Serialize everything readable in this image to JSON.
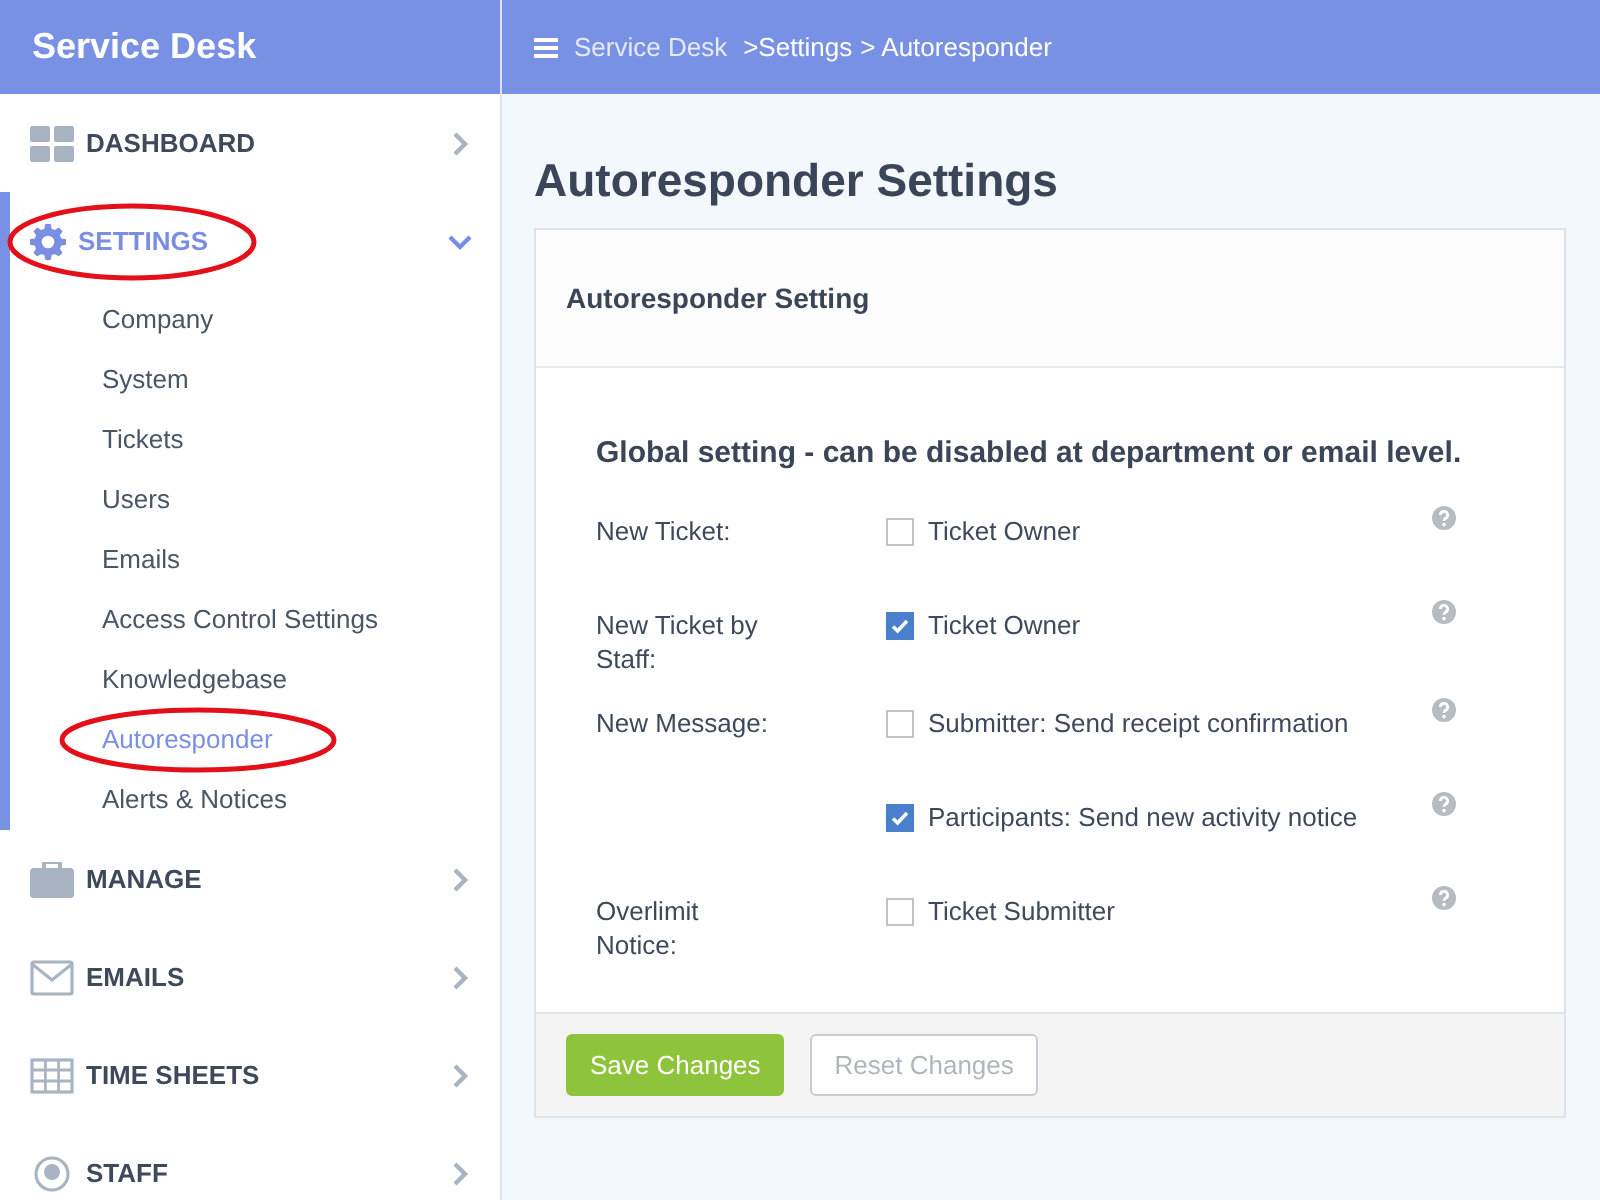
{
  "sidebar": {
    "title": "Service Desk",
    "items": [
      {
        "label": "DASHBOARD",
        "expanded": false,
        "selected": false,
        "circled": false
      },
      {
        "label": "SETTINGS",
        "expanded": true,
        "selected": true,
        "circled": true,
        "children": [
          {
            "label": "Company",
            "selected": false,
            "circled": false
          },
          {
            "label": "System",
            "selected": false,
            "circled": false
          },
          {
            "label": "Tickets",
            "selected": false,
            "circled": false
          },
          {
            "label": "Users",
            "selected": false,
            "circled": false
          },
          {
            "label": "Emails",
            "selected": false,
            "circled": false
          },
          {
            "label": "Access Control Settings",
            "selected": false,
            "circled": false
          },
          {
            "label": "Knowledgebase",
            "selected": false,
            "circled": false
          },
          {
            "label": "Autoresponder",
            "selected": true,
            "circled": true
          },
          {
            "label": "Alerts & Notices",
            "selected": false,
            "circled": false
          }
        ]
      },
      {
        "label": "MANAGE",
        "expanded": false,
        "selected": false,
        "circled": false
      },
      {
        "label": "EMAILS",
        "expanded": false,
        "selected": false,
        "circled": false
      },
      {
        "label": "TIME SHEETS",
        "expanded": false,
        "selected": false,
        "circled": false
      },
      {
        "label": "STAFF",
        "expanded": false,
        "selected": false,
        "circled": false
      }
    ]
  },
  "breadcrumb": [
    "Service Desk",
    ">Settings",
    "> Autoresponder"
  ],
  "page_title": "Autoresponder Settings",
  "card": {
    "title": "Autoresponder Setting",
    "notice": "Global setting - can be disabled at department or email level.",
    "rows": [
      {
        "label": "New Ticket:",
        "options": [
          {
            "label": "Ticket Owner",
            "checked": false
          }
        ]
      },
      {
        "label": "New Ticket by Staff:",
        "options": [
          {
            "label": "Ticket Owner",
            "checked": true
          }
        ]
      },
      {
        "label": "New Message:",
        "options": [
          {
            "label": "Submitter: Send receipt confirmation",
            "checked": false
          },
          {
            "label": "Participants: Send new activity notice",
            "checked": true
          }
        ]
      },
      {
        "label": "Overlimit Notice:",
        "options": [
          {
            "label": "Ticket Submitter",
            "checked": false
          }
        ]
      }
    ],
    "buttons": [
      {
        "label": "Save Changes",
        "kind": "primary"
      },
      {
        "label": "Reset Changes",
        "kind": "secondary"
      }
    ]
  }
}
